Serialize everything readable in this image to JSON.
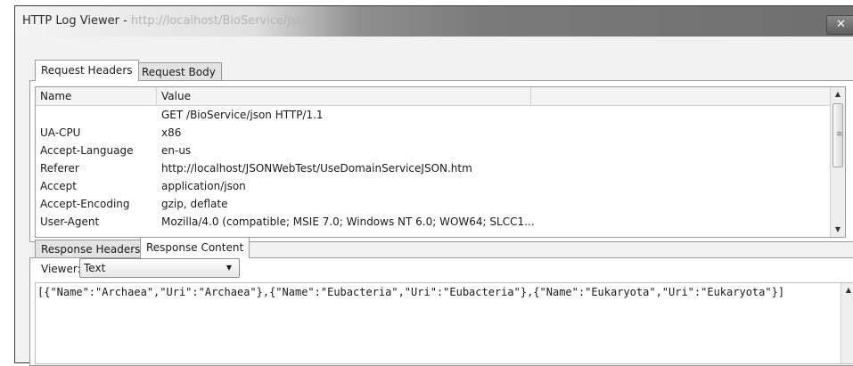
{
  "window": {
    "title_prefix": "HTTP Log Viewer - ",
    "title_url": "http://localhost/BioService/json",
    "close_glyph": "✕"
  },
  "request_tabs": [
    {
      "label": "Request Headers",
      "active": true
    },
    {
      "label": "Request Body",
      "active": false
    }
  ],
  "headers_grid": {
    "columns": [
      "Name",
      "Value"
    ],
    "rows": [
      {
        "name": "",
        "value": "GET /BioService/json HTTP/1.1"
      },
      {
        "name": "UA-CPU",
        "value": "x86"
      },
      {
        "name": "Accept-Language",
        "value": "en-us"
      },
      {
        "name": "Referer",
        "value": "http://localhost/JSONWebTest/UseDomainServiceJSON.htm"
      },
      {
        "name": "Accept",
        "value": "application/json"
      },
      {
        "name": "Accept-Encoding",
        "value": "gzip, deflate"
      },
      {
        "name": "User-Agent",
        "value": "Mozilla/4.0 (compatible; MSIE 7.0; Windows NT 6.0; WOW64; SLCC1..."
      }
    ]
  },
  "response_tabs": [
    {
      "label": "Response Headers",
      "active": false
    },
    {
      "label": "Response Content",
      "active": true
    }
  ],
  "viewer": {
    "label": "Viewer:",
    "selected": "Text"
  },
  "response_content": "[{\"Name\":\"Archaea\",\"Uri\":\"Archaea\"},{\"Name\":\"Eubacteria\",\"Uri\":\"Eubacteria\"},{\"Name\":\"Eukaryota\",\"Uri\":\"Eukaryota\"}]"
}
